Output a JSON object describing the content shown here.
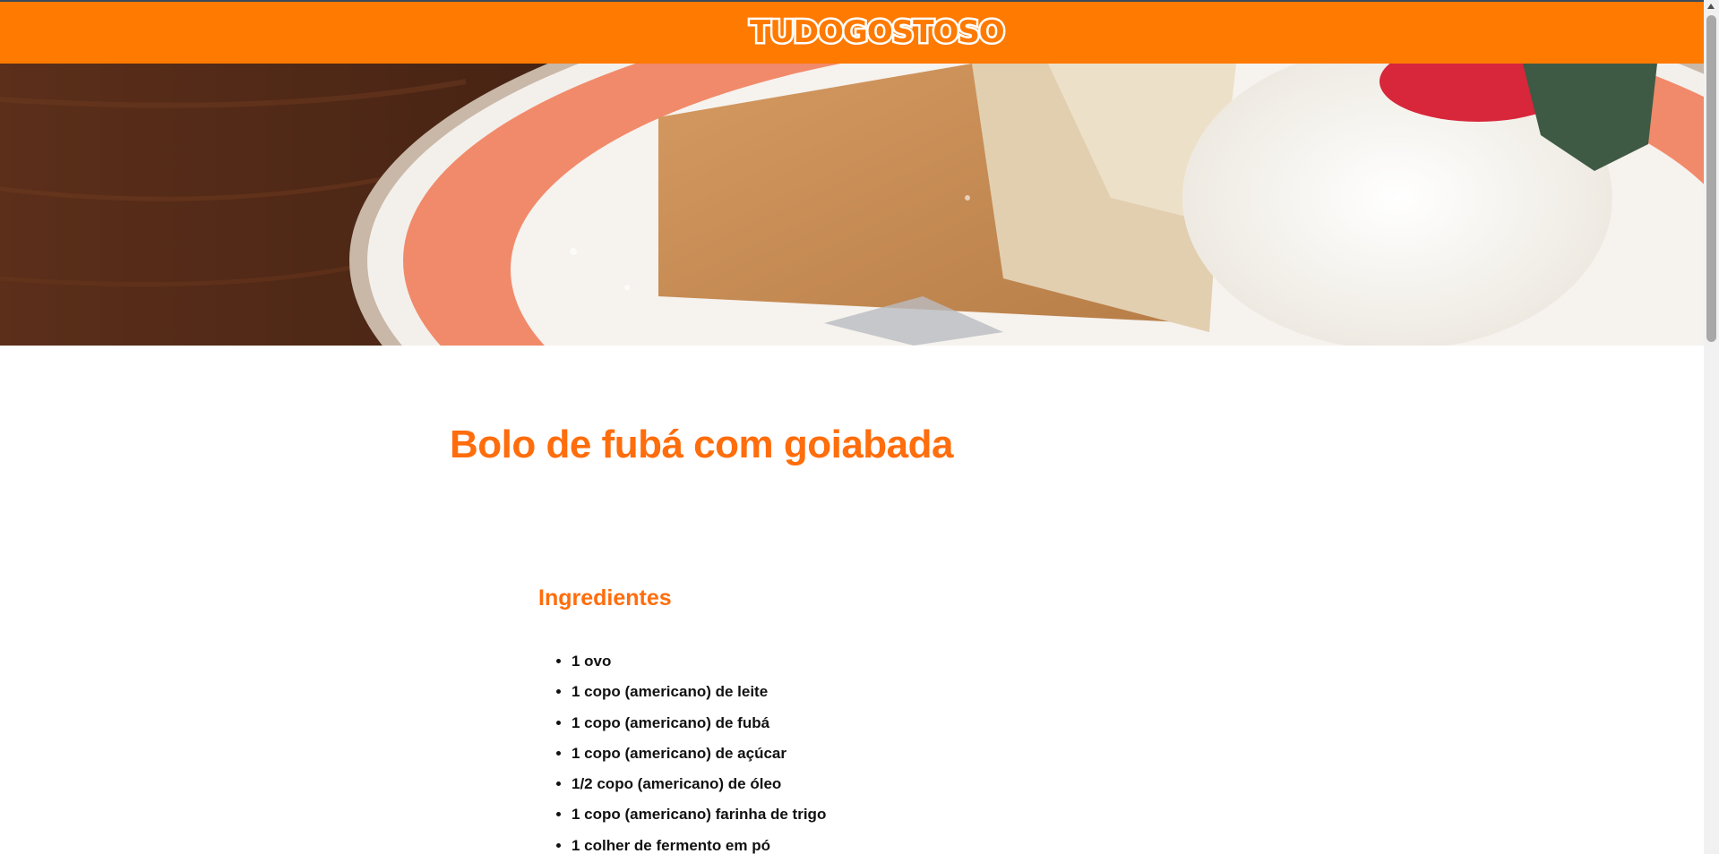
{
  "header": {
    "logo_text": "TUDOGOSTOSO",
    "brand_color": "#ff7a00"
  },
  "hero": {
    "image": "cake-slice-with-whipped-cream-photo"
  },
  "recipe": {
    "title": "Bolo de fubá com goiabada",
    "ingredients_heading": "Ingredientes",
    "ingredients": [
      "1 ovo",
      "1 copo (americano) de leite",
      "1 copo (americano) de fubá",
      "1 copo (americano) de açúcar",
      "1/2 copo (americano) de óleo",
      "1 copo (americano) farinha de trigo",
      "1 colher de fermento em pó"
    ],
    "accent_color": "#ff6d0c"
  }
}
